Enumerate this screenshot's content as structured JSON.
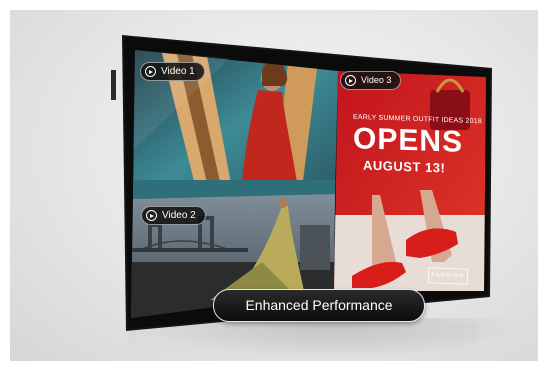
{
  "videos": [
    {
      "label": "Video 1"
    },
    {
      "label": "Video 2"
    },
    {
      "label": "Video 3"
    }
  ],
  "ad": {
    "subtitle": "EARLY SUMMER OUTFIT IDEAS 2018",
    "headline": "OPENS",
    "date": "AUGUST 13!",
    "brand": "FASHION"
  },
  "banner": {
    "label": "Enhanced Performance"
  },
  "icons": [
    "play-icon"
  ]
}
